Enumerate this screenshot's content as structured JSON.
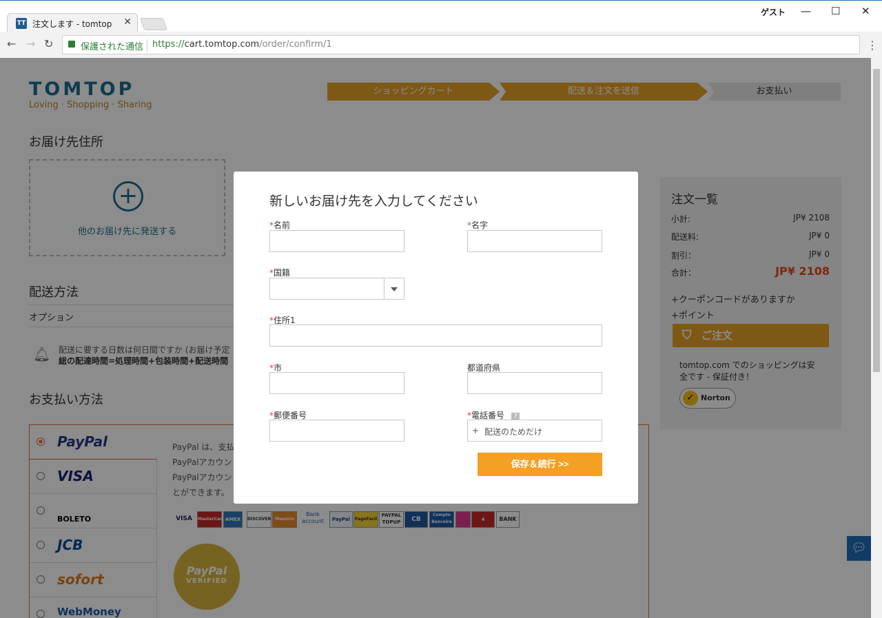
{
  "browser": {
    "tab_title": "注文します - tomtop",
    "tab_favicon": "TT",
    "user_label": "ゲスト",
    "secure_label": "保護された通信",
    "url_scheme": "https://",
    "url_host": "cart.tomtop.com",
    "url_path": "/order/confirm/1"
  },
  "header": {
    "logo": "TOMTOP",
    "tagline": "Loving · Shopping · Sharing",
    "steps": [
      "ショッピングカート",
      "配送＆注文を送信",
      "お支払い"
    ]
  },
  "shipping_address": {
    "title": "お届け先住所",
    "add_label": "他のお届け先に発送する"
  },
  "shipping_method": {
    "title": "配送方法",
    "option_label": "オプション",
    "notice_line1": "配送に要する日数は何日間ですか (お届け予定",
    "notice_line2": "総の配達時間=処理時間+包装時間+配送時間"
  },
  "payment": {
    "title": "お支払い方法",
    "methods": [
      "PayPal",
      "VISA",
      "BOLETO",
      "JCB",
      "sofort",
      "WebMoney"
    ],
    "desc_lines": [
      "PayPal は、支払",
      "PayPalアカウン",
      "PayPalアカウン",
      "とができます。"
    ],
    "cards": [
      "VISA",
      "MasterCard",
      "AMEX",
      "DISCOVER",
      "Maestro",
      "Bank account",
      "PayPal",
      "PagoFacil",
      "PAYPAL TOPUP",
      "CB",
      "Compte Bancaire",
      "",
      "4 etoiles",
      "BANK"
    ],
    "seal_top": "PayPal",
    "seal_bottom": "VERIFIED"
  },
  "summary": {
    "title": "注文一覧",
    "rows": [
      {
        "label": "小計:",
        "value": "JP¥ 2108"
      },
      {
        "label": "配送料:",
        "value": "JP¥ 0"
      },
      {
        "label": "割引：",
        "value": "JP¥  0"
      }
    ],
    "total_label": "合計：",
    "total_value": "JP¥  2108",
    "coupon": "+クーポンコードがありますか",
    "points": "+ポイント",
    "order_button": "ご注文",
    "secure_text": "tomtop.com でのショッピングは安全です - 保証付き！",
    "norton": "Norton"
  },
  "modal": {
    "title": "新しいお届け先を入力してください",
    "fields": {
      "first_name": "名前",
      "last_name": "名字",
      "country": "国籍",
      "address1": "住所1",
      "city": "市",
      "state": "都道府県",
      "zip": "郵便番号",
      "phone": "電話番号"
    },
    "phone_prefix": "+",
    "phone_placeholder": "配送のためだけ",
    "save_button": "保存＆続行 >>"
  },
  "colors": {
    "brand_blue": "#1d6e8f",
    "step_active": "#e5a127",
    "accent_orange": "#f4a024",
    "total_red": "#e34a1d"
  }
}
